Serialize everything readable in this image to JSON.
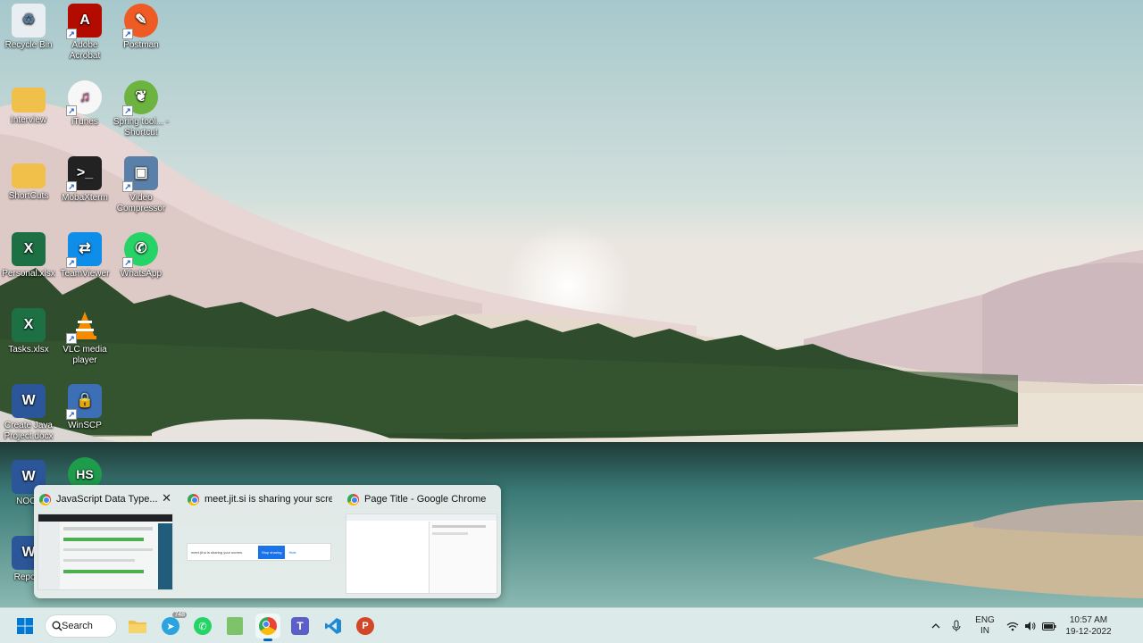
{
  "desktop": {
    "icons": [
      {
        "label": "Recycle Bin",
        "color": "#e9eef3"
      },
      {
        "label": "Adobe Acrobat",
        "color": "#b30b00"
      },
      {
        "label": "Postman",
        "color": "#ef5b25"
      },
      {
        "label": "Interview",
        "color": "#f1c04a"
      },
      {
        "label": "iTunes",
        "color": "#f7f7f7"
      },
      {
        "label": "Spring tool... - Shortcut",
        "color": "#6db33f"
      },
      {
        "label": "ShortCuts",
        "color": "#f1c04a"
      },
      {
        "label": "MobaXterm",
        "color": "#222222"
      },
      {
        "label": "Video Compressor",
        "color": "#5a7fa8"
      },
      {
        "label": "Personal.xlsx",
        "color": "#1d7044"
      },
      {
        "label": "TeamViewer",
        "color": "#0e8ee9"
      },
      {
        "label": "WhatsApp",
        "color": "#25d366"
      },
      {
        "label": "Tasks.xlsx",
        "color": "#1d7044"
      },
      {
        "label": "VLC media player",
        "color": "#f48b00"
      },
      {
        "label": "Create Java Project.docx",
        "color": "#2b579a"
      },
      {
        "label": "WinSCP",
        "color": "#3d6fb6"
      },
      {
        "label": "NOCo",
        "color": "#2b579a"
      },
      {
        "label": "HS",
        "color": "#1e9c4b"
      },
      {
        "label": "Report.",
        "color": "#2b579a"
      }
    ]
  },
  "preview": {
    "items": [
      {
        "title": "JavaScript Data Type...",
        "close": "✕"
      },
      {
        "title": "meet.jit.si is sharing your screen.",
        "share_text": "meet.jit.si is sharing your screen.",
        "stop_label": "Stop sharing",
        "hide_label": "Hide"
      },
      {
        "title": "Page Title - Google Chrome"
      }
    ]
  },
  "taskbar": {
    "search_label": "Search",
    "telegram_badge": "748",
    "apps": [
      "start-icon",
      "file-explorer-icon",
      "telegram-icon",
      "whatsapp-icon",
      "notepad-icon",
      "chrome-icon",
      "teams-icon",
      "vscode-icon",
      "powerpoint-icon"
    ],
    "tray": {
      "lang_top": "ENG",
      "lang_bottom": "IN",
      "time": "10:57 AM",
      "date": "19-12-2022"
    }
  }
}
